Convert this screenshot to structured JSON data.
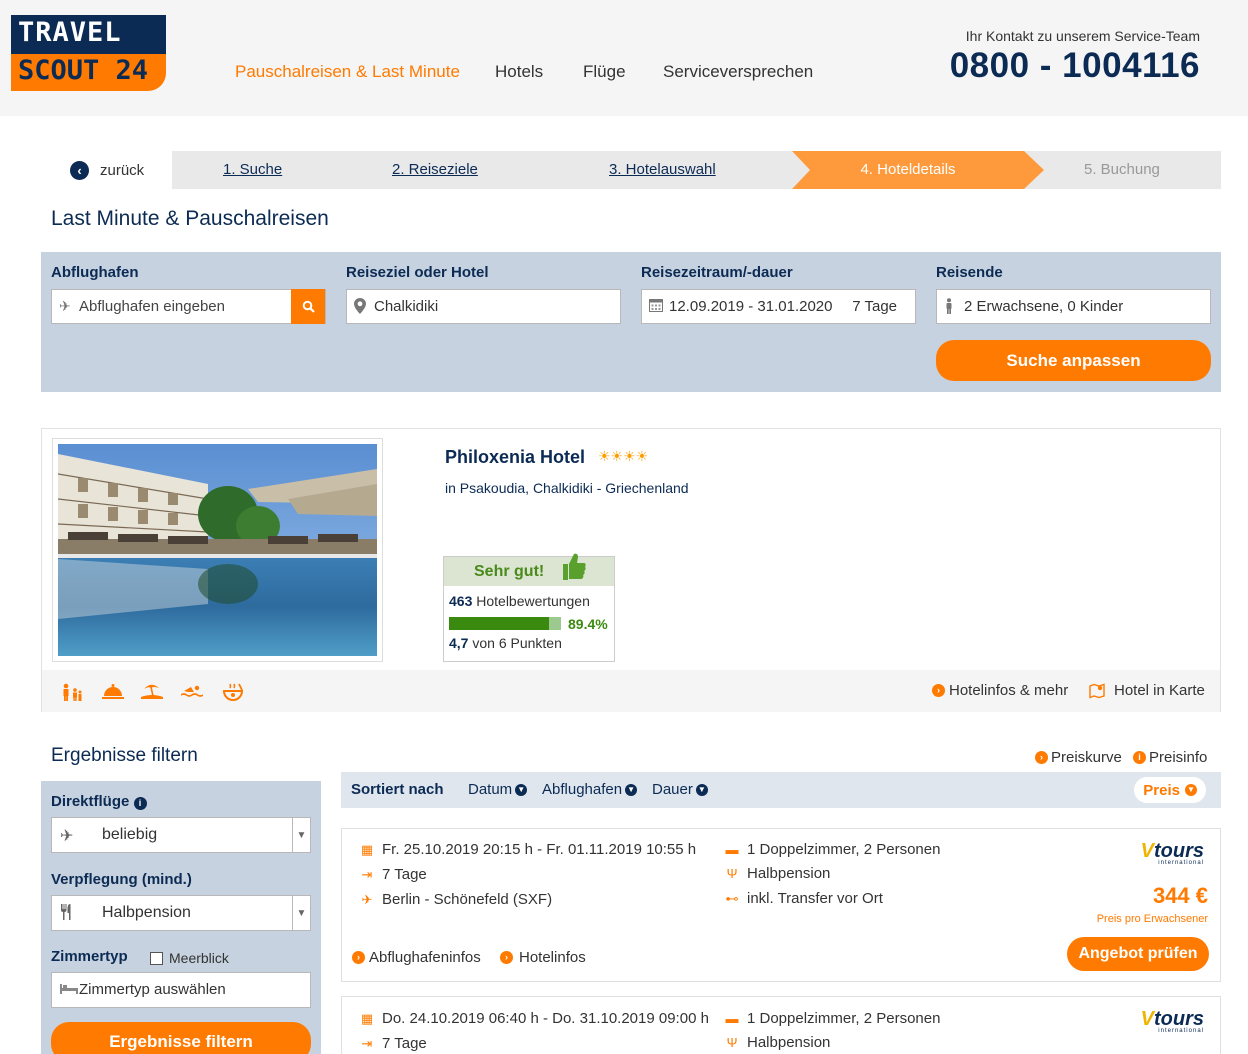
{
  "logo": {
    "line1": "TRAVEL",
    "line2": "SCOUT 24"
  },
  "nav": {
    "items": [
      "Pauschalreisen & Last Minute",
      "Hotels",
      "Flüge",
      "Serviceversprechen"
    ]
  },
  "contact": {
    "label": "Ihr Kontakt zu unserem Service-Team",
    "phone": "0800 - 1004116"
  },
  "breadcrumb": {
    "back": "zurück",
    "steps": [
      "1. Suche",
      "2. Reiseziele",
      "3. Hotelauswahl",
      "4. Hoteldetails",
      "5. Buchung"
    ],
    "active_step": "4. Hoteldetails"
  },
  "page_title": "Last Minute & Pauschalreisen",
  "search": {
    "airport_label": "Abflughafen",
    "airport_placeholder": "Abflughafen eingeben",
    "dest_label": "Reiseziel oder Hotel",
    "dest_value": "Chalkidiki",
    "period_label": "Reisezeitraum/-dauer",
    "period_value": "12.09.2019 - 31.01.2020",
    "duration_value": "7 Tage",
    "travelers_label": "Reisende",
    "travelers_value": "2 Erwachsene, 0 Kinder",
    "submit": "Suche anpassen"
  },
  "hotel": {
    "name": "Philoxenia Hotel",
    "stars": "☀☀☀☀",
    "location": "in Psakoudia, Chalkidiki - Griechenland",
    "rating_title": "Sehr gut!",
    "reviews_count": "463",
    "reviews_label": "Hotelbewertungen",
    "recommend_pct": "89.4%",
    "recommend_fraction": 0.894,
    "score": "4,7",
    "score_label": "von 6 Punkten",
    "links": {
      "info": "Hotelinfos & mehr",
      "map": "Hotel in Karte"
    }
  },
  "filters": {
    "title": "Ergebnisse filtern",
    "direct_label": "Direktflüge",
    "direct_value": "beliebig",
    "board_label": "Verpflegung (mind.)",
    "board_value": "Halbpension",
    "room_label": "Zimmertyp",
    "seaview_label": "Meerblick",
    "room_placeholder": "Zimmertyp auswählen",
    "submit": "Ergebnisse filtern"
  },
  "results": {
    "links": {
      "curve": "Preiskurve",
      "info": "Preisinfo"
    },
    "sort_label": "Sortiert nach",
    "sort_options": [
      "Datum",
      "Abflughafen",
      "Dauer"
    ],
    "sort_active": "Preis",
    "offers": [
      {
        "dates": "Fr. 25.10.2019 20:15 h - Fr. 01.11.2019 10:55 h",
        "duration": "7 Tage",
        "airport": "Berlin - Schönefeld (SXF)",
        "room": "1 Doppelzimmer, 2 Personen",
        "board": "Halbpension",
        "transfer": "inkl. Transfer vor Ort",
        "operator": "tours",
        "operator_sub": "international",
        "price": "344 €",
        "price_note": "Preis pro Erwachsener",
        "cta": "Angebot prüfen",
        "link_airport": "Abflughafeninfos",
        "link_hotel": "Hotelinfos"
      },
      {
        "dates": "Do. 24.10.2019 06:40 h - Do. 31.10.2019 09:00 h",
        "duration": "7 Tage",
        "room": "1 Doppelzimmer, 2 Personen",
        "board": "Halbpension",
        "operator": "tours",
        "operator_sub": "international"
      }
    ]
  }
}
